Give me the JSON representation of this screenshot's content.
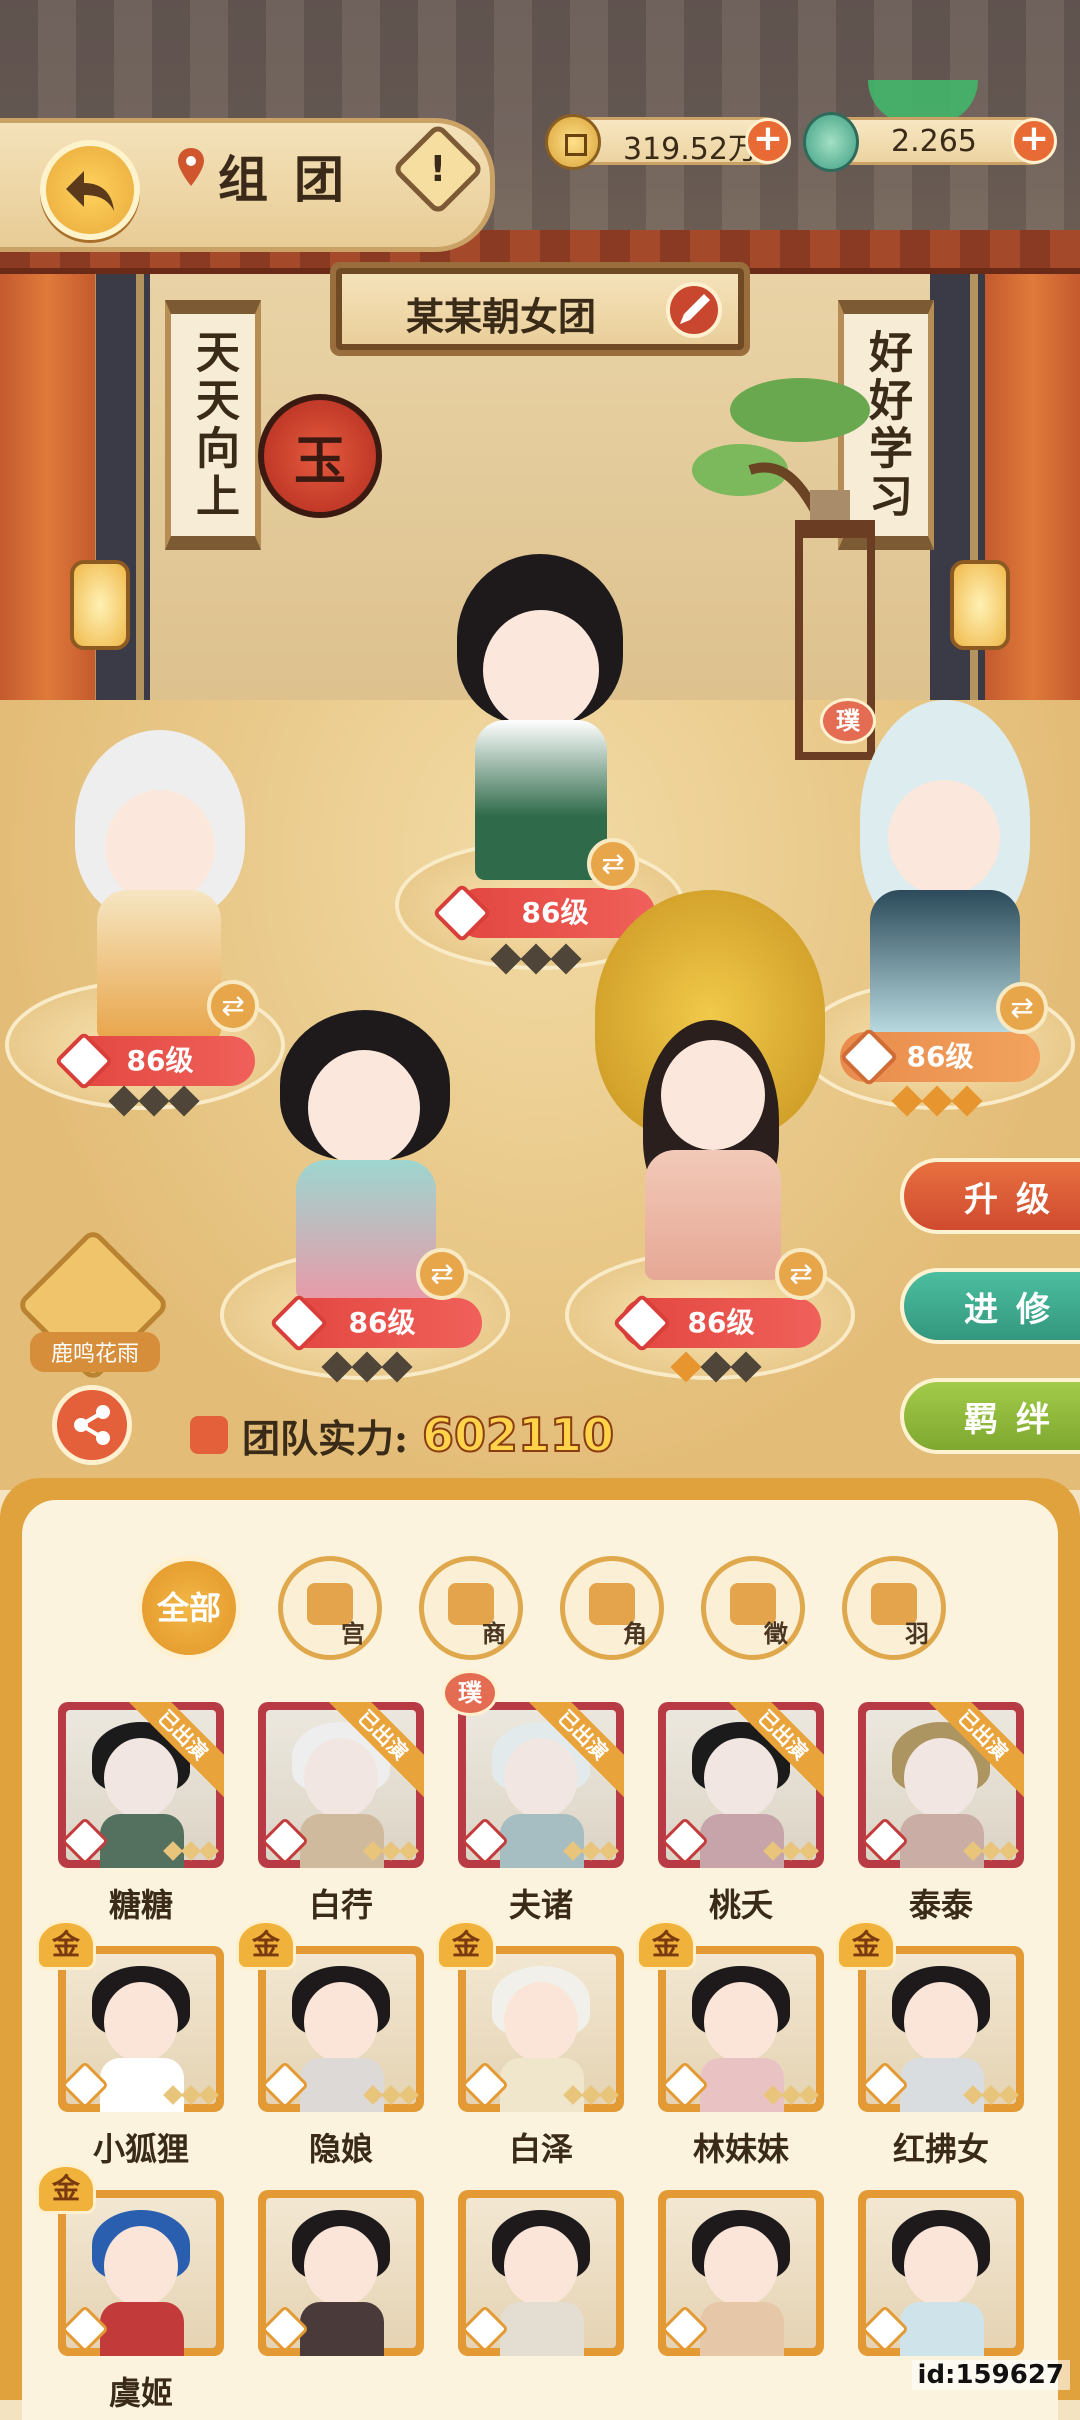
{
  "header": {
    "title": "组团",
    "help_symbol": "!",
    "coins": "319.52万",
    "jade": "2.265",
    "plus": "+"
  },
  "team": {
    "name": "某某朝女团",
    "rank_badge": "玉",
    "scroll_left": "天天向上",
    "scroll_right": "好好学习"
  },
  "lineup": [
    {
      "level": "86级",
      "stars_on": 0
    },
    {
      "level": "86级",
      "stars_on": 0
    },
    {
      "level": "86级",
      "stars_on": 3,
      "tag": "璞"
    },
    {
      "level": "86级",
      "stars_on": 0
    },
    {
      "level": "86级",
      "stars_on": 1
    }
  ],
  "side_buttons": {
    "upgrade": "升级",
    "advance": "进修",
    "bond": "羁绊"
  },
  "event": {
    "label": "鹿鸣花雨"
  },
  "power": {
    "label": "团队实力:",
    "value": "602110"
  },
  "filters": [
    {
      "label": "全部"
    },
    {
      "label": "宫"
    },
    {
      "label": "商"
    },
    {
      "label": "角"
    },
    {
      "label": "徵"
    },
    {
      "label": "羽"
    }
  ],
  "roster": {
    "in_play_label": "已出演",
    "gold_label": "金",
    "pu_label": "璞",
    "row1": [
      "糖糖",
      "白荇",
      "夫诸",
      "桃夭",
      "泰泰"
    ],
    "row2": [
      "小狐狸",
      "隐娘",
      "白泽",
      "林妹妹",
      "红拂女"
    ],
    "row3": [
      "虞姬",
      "",
      "",
      "",
      ""
    ]
  },
  "uid": "id:159627",
  "colors": {
    "accent_orange": "#e29428",
    "level_red": "#e2463f",
    "upgrade_button": "#e05a38",
    "advance_button": "#3fae92",
    "bond_button": "#8fbc3b"
  }
}
